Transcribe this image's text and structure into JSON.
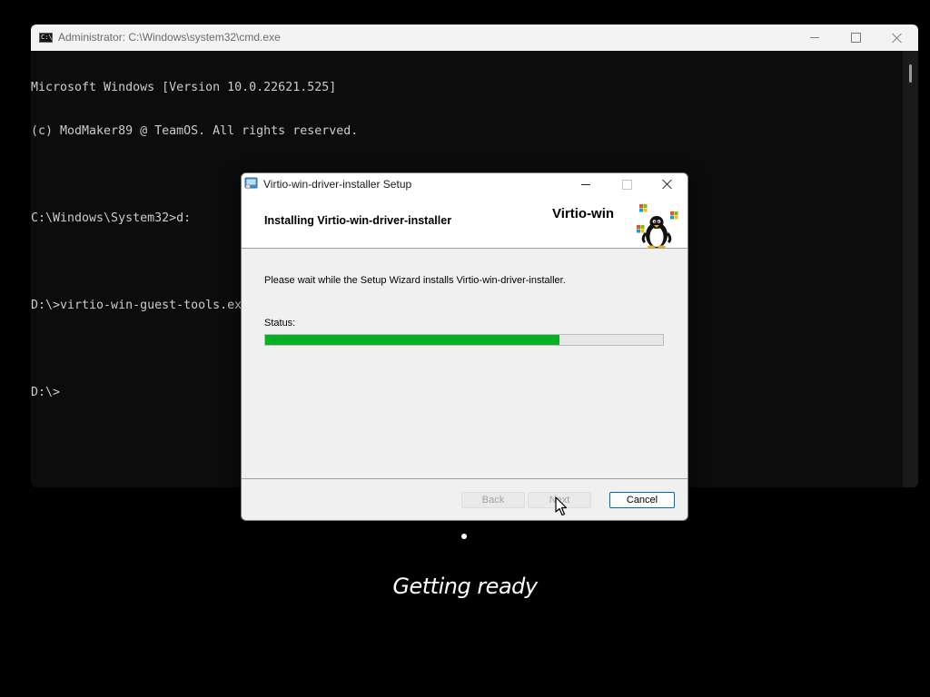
{
  "cmd_window": {
    "title": "Administrator: C:\\Windows\\system32\\cmd.exe",
    "icon_text": "C:\\",
    "lines": [
      "Microsoft Windows [Version 10.0.22621.525]",
      "(c) ModMaker89 @ TeamOS. All rights reserved.",
      "",
      "C:\\Windows\\System32>d:",
      "",
      "D:\\>virtio-win-guest-tools.exe",
      "",
      "D:\\>"
    ]
  },
  "setup_dialog": {
    "title": "Virtio-win-driver-installer Setup",
    "heading": "Installing Virtio-win-driver-installer",
    "brand": "Virtio-win",
    "message": "Please wait while the Setup Wizard installs Virtio-win-driver-installer.",
    "status_label": "Status:",
    "progress_percent": 74,
    "buttons": {
      "back": "Back",
      "next": "Next",
      "cancel": "Cancel"
    }
  },
  "boot_status": "Getting ready",
  "colors": {
    "progress_fill": "#06b025",
    "accent": "#0067c0",
    "console_bg": "#0c0c0c",
    "console_text": "#cccccc"
  }
}
